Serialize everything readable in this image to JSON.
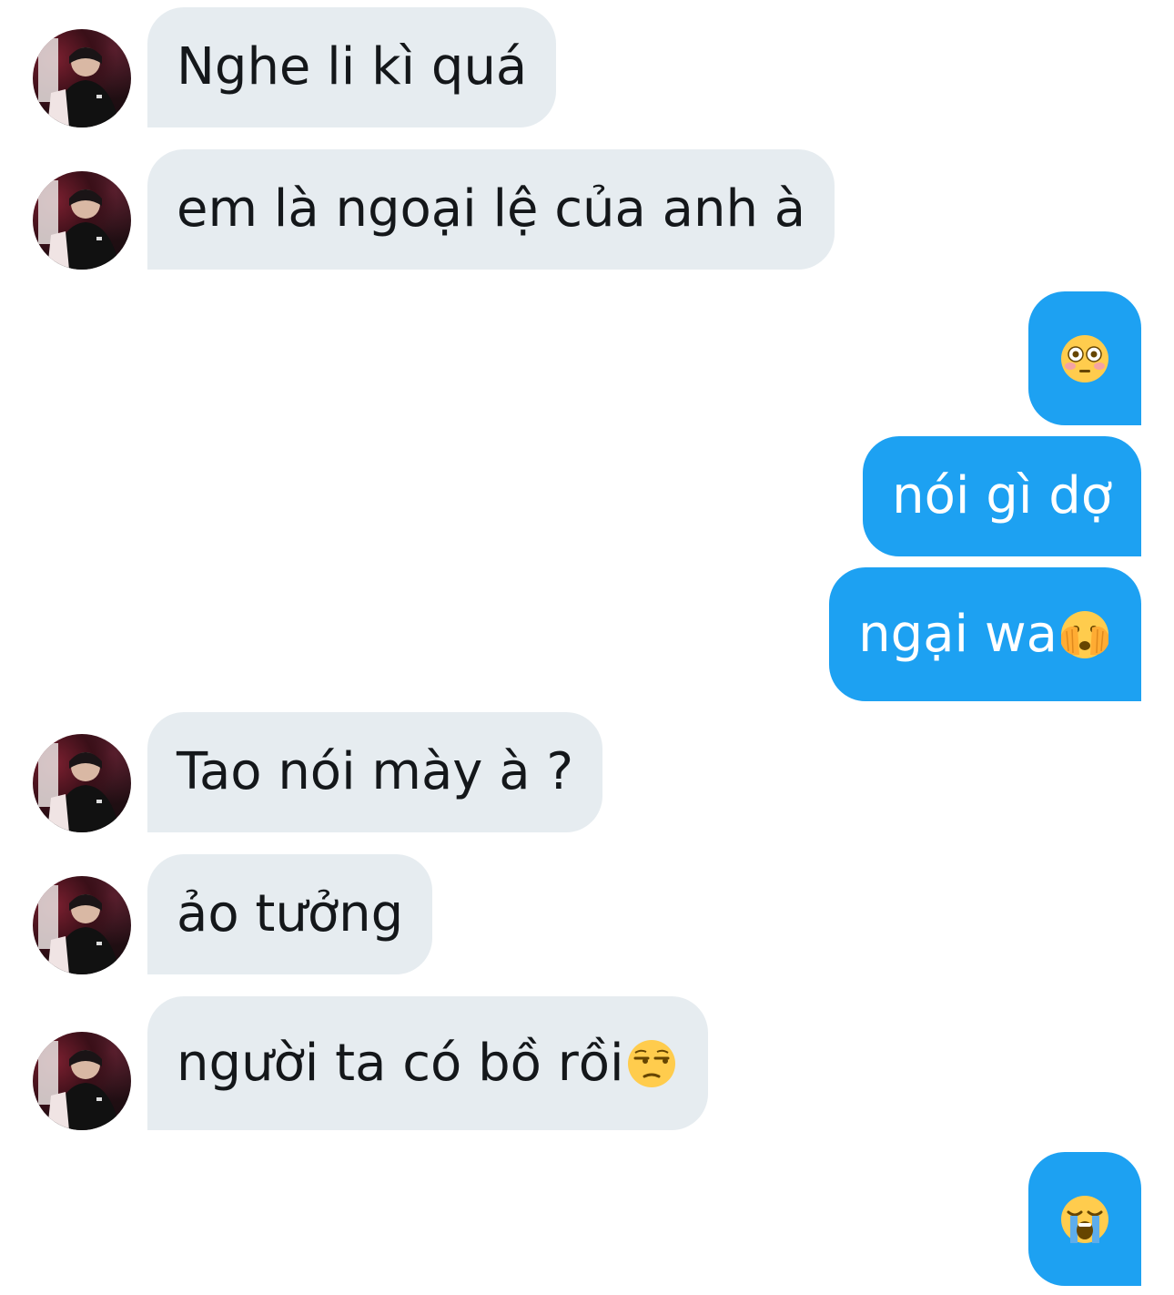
{
  "messages": [
    {
      "side": "received",
      "text": "Nghe li kì quá"
    },
    {
      "side": "received",
      "text": "em là ngoại lệ của anh à"
    },
    {
      "side": "sent",
      "text": "",
      "emoji": "flushed-face-icon"
    },
    {
      "side": "sent",
      "text": "nói gì dợ"
    },
    {
      "side": "sent",
      "text": "ngại wa",
      "emoji": "face-with-hand-over-eyes-icon"
    },
    {
      "side": "received",
      "text": "Tao nói mày à ?"
    },
    {
      "side": "received",
      "text": "ảo tưởng"
    },
    {
      "side": "received",
      "text": "người ta có bồ rồi",
      "emoji": "unamused-face-icon"
    },
    {
      "side": "sent",
      "text": "",
      "emoji": "loudly-crying-face-icon"
    }
  ],
  "colors": {
    "received_bubble": "#e6ecf0",
    "received_text": "#14171a",
    "sent_bubble": "#1da1f2",
    "sent_text": "#ffffff",
    "background": "#ffffff"
  }
}
